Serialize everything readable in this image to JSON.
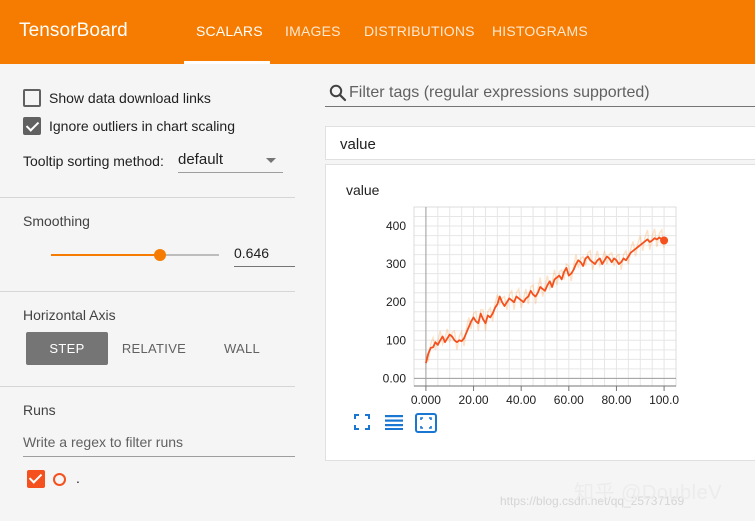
{
  "header": {
    "title": "TensorBoard",
    "tabs": [
      {
        "label": "SCALARS",
        "active": true
      },
      {
        "label": "IMAGES",
        "active": false
      },
      {
        "label": "DISTRIBUTIONS",
        "active": false
      },
      {
        "label": "HISTOGRAMS",
        "active": false
      }
    ],
    "accent_color": "#f57c00"
  },
  "sidebar": {
    "show_download_links": {
      "label": "Show data download links",
      "checked": false
    },
    "ignore_outliers": {
      "label": "Ignore outliers in chart scaling",
      "checked": true
    },
    "tooltip_sorting": {
      "label": "Tooltip sorting method:",
      "value": "default"
    },
    "smoothing": {
      "title": "Smoothing",
      "value": "0.646",
      "fraction": 0.646
    },
    "horizontal_axis": {
      "title": "Horizontal Axis",
      "options": [
        {
          "label": "STEP",
          "active": true
        },
        {
          "label": "RELATIVE",
          "active": false
        },
        {
          "label": "WALL",
          "active": false
        }
      ]
    },
    "runs": {
      "title": "Runs",
      "filter_placeholder": "Write a regex to filter runs",
      "items": [
        {
          "name": ".",
          "checked": true,
          "color": "#f4511e"
        }
      ]
    }
  },
  "main": {
    "filter_placeholder": "Filter tags (regular expressions supported)",
    "group_title": "value",
    "card_title": "value",
    "tools": [
      "fullscreen-icon",
      "log-scale-icon",
      "fit-domain-icon"
    ]
  },
  "chart_data": {
    "type": "line",
    "title": "value",
    "xlabel": "",
    "ylabel": "",
    "xlim": [
      -5,
      105
    ],
    "ylim": [
      -20,
      450
    ],
    "x_ticks": [
      "0.000",
      "20.00",
      "40.00",
      "60.00",
      "80.00",
      "100.0"
    ],
    "y_ticks": [
      "0.00",
      "100",
      "200",
      "300",
      "400"
    ],
    "grid": true,
    "series": [
      {
        "color": "#f57c00",
        "x": [
          0,
          1,
          2,
          3,
          4,
          5,
          6,
          7,
          8,
          9,
          10,
          11,
          12,
          13,
          14,
          15,
          16,
          17,
          18,
          19,
          20,
          21,
          22,
          23,
          24,
          25,
          26,
          27,
          28,
          29,
          30,
          31,
          32,
          33,
          34,
          35,
          36,
          37,
          38,
          39,
          40,
          41,
          42,
          43,
          44,
          45,
          46,
          47,
          48,
          49,
          50,
          51,
          52,
          53,
          54,
          55,
          56,
          57,
          58,
          59,
          60,
          61,
          62,
          63,
          64,
          65,
          66,
          67,
          68,
          69,
          70,
          71,
          72,
          73,
          74,
          75,
          76,
          77,
          78,
          79,
          80,
          81,
          82,
          83,
          84,
          85,
          86,
          87,
          88,
          89,
          90,
          91,
          92,
          93,
          94,
          95,
          96,
          97,
          98,
          99,
          100
        ],
        "y": [
          40,
          65,
          80,
          82,
          95,
          88,
          100,
          110,
          95,
          105,
          115,
          110,
          100,
          95,
          100,
          98,
          105,
          120,
          135,
          150,
          160,
          150,
          145,
          170,
          155,
          145,
          165,
          160,
          170,
          185,
          195,
          215,
          200,
          190,
          200,
          210,
          205,
          200,
          215,
          210,
          205,
          200,
          210,
          215,
          230,
          220,
          215,
          225,
          240,
          235,
          230,
          245,
          255,
          240,
          260,
          265,
          270,
          260,
          280,
          290,
          270,
          275,
          285,
          300,
          310,
          305,
          295,
          315,
          320,
          310,
          305,
          300,
          310,
          315,
          300,
          310,
          320,
          315,
          305,
          315,
          310,
          300,
          305,
          315,
          310,
          320,
          330,
          335,
          340,
          345,
          350,
          355,
          360,
          365,
          358,
          362,
          368,
          365,
          370,
          365,
          362
        ]
      }
    ]
  },
  "watermark": "https://blog.csdn.net/qq_25737169",
  "zhihu_mark": "知乎 @DoubleV"
}
